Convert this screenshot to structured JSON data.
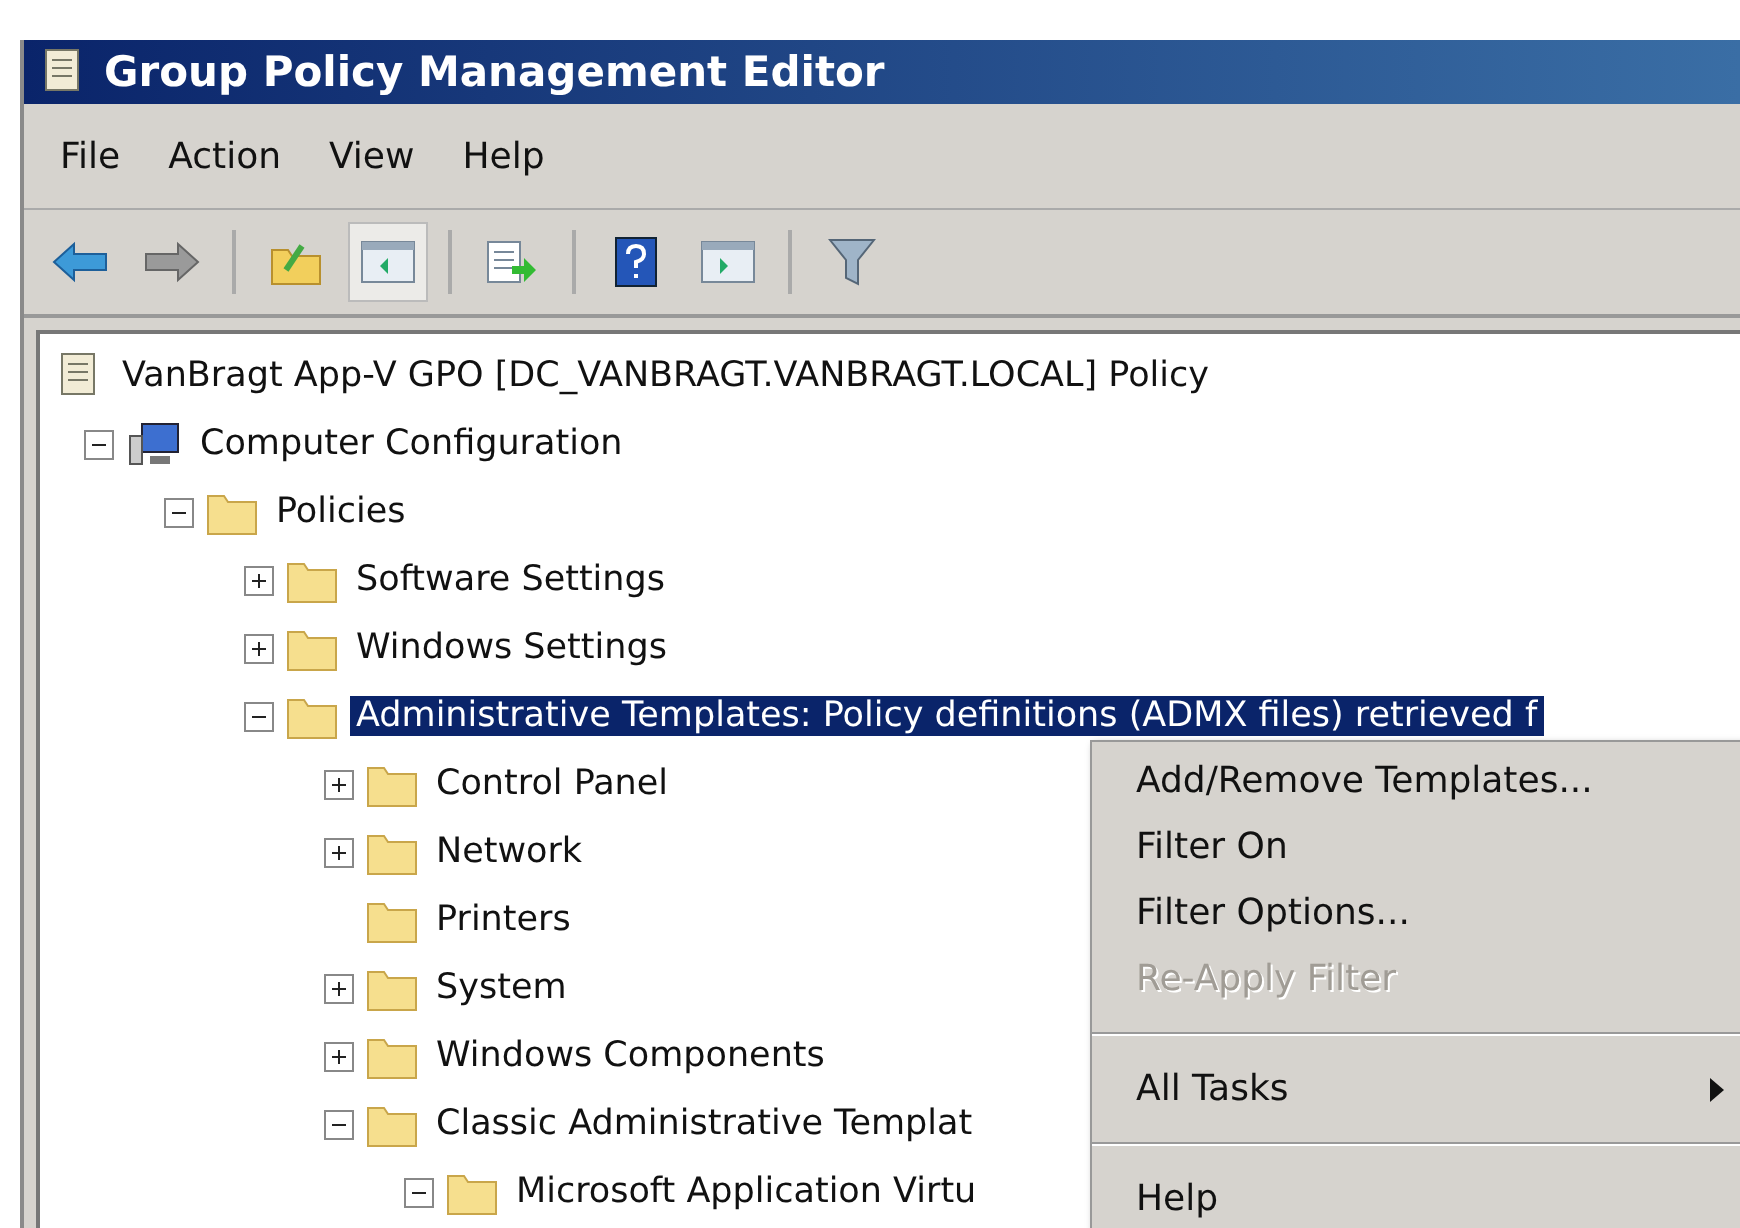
{
  "window": {
    "title": "Group Policy Management Editor"
  },
  "menu_bar": [
    "File",
    "Action",
    "View",
    "Help"
  ],
  "toolbar": [
    {
      "kind": "back"
    },
    {
      "kind": "forward"
    },
    {
      "kind": "sep"
    },
    {
      "kind": "up"
    },
    {
      "kind": "pane",
      "selected": true
    },
    {
      "kind": "sep"
    },
    {
      "kind": "export"
    },
    {
      "kind": "sep"
    },
    {
      "kind": "help"
    },
    {
      "kind": "pane2"
    },
    {
      "kind": "sep"
    },
    {
      "kind": "filter"
    }
  ],
  "tree": [
    {
      "label": "VanBragt App-V GPO [DC_VANBRAGT.VANBRAGT.LOCAL] Policy",
      "kind": "policy",
      "children": [
        {
          "label": "Computer Configuration",
          "kind": "computer",
          "expanded": true,
          "children": [
            {
              "label": "Policies",
              "kind": "folder",
              "expanded": true,
              "children": [
                {
                  "label": "Software Settings",
                  "kind": "folder",
                  "expanded": false
                },
                {
                  "label": "Windows Settings",
                  "kind": "folder",
                  "expanded": false
                },
                {
                  "label": "Administrative Templates: Policy definitions (ADMX files) retrieved f",
                  "kind": "folder",
                  "expanded": true,
                  "selected": true,
                  "children": [
                    {
                      "label": "Control Panel",
                      "kind": "folder",
                      "expanded": false
                    },
                    {
                      "label": "Network",
                      "kind": "folder",
                      "expanded": false
                    },
                    {
                      "label": "Printers",
                      "kind": "folder"
                    },
                    {
                      "label": "System",
                      "kind": "folder",
                      "expanded": false
                    },
                    {
                      "label": "Windows Components",
                      "kind": "folder",
                      "expanded": false
                    },
                    {
                      "label": "Classic Administrative Templat",
                      "kind": "folder",
                      "expanded": true,
                      "children": [
                        {
                          "label": "Microsoft Application Virtu",
                          "kind": "folder",
                          "expanded": true
                        }
                      ]
                    }
                  ]
                }
              ]
            }
          ]
        }
      ]
    }
  ],
  "context_menu": [
    {
      "kind": "item",
      "label": "Add/Remove Templates...",
      "disabled": false
    },
    {
      "kind": "item",
      "label": "Filter On",
      "disabled": false
    },
    {
      "kind": "item",
      "label": "Filter Options...",
      "disabled": false
    },
    {
      "kind": "item",
      "label": "Re-Apply Filter",
      "disabled": true
    },
    {
      "kind": "separator"
    },
    {
      "kind": "submenu",
      "label": "All Tasks",
      "disabled": false
    },
    {
      "kind": "separator"
    },
    {
      "kind": "item",
      "label": "Help",
      "disabled": false
    }
  ]
}
